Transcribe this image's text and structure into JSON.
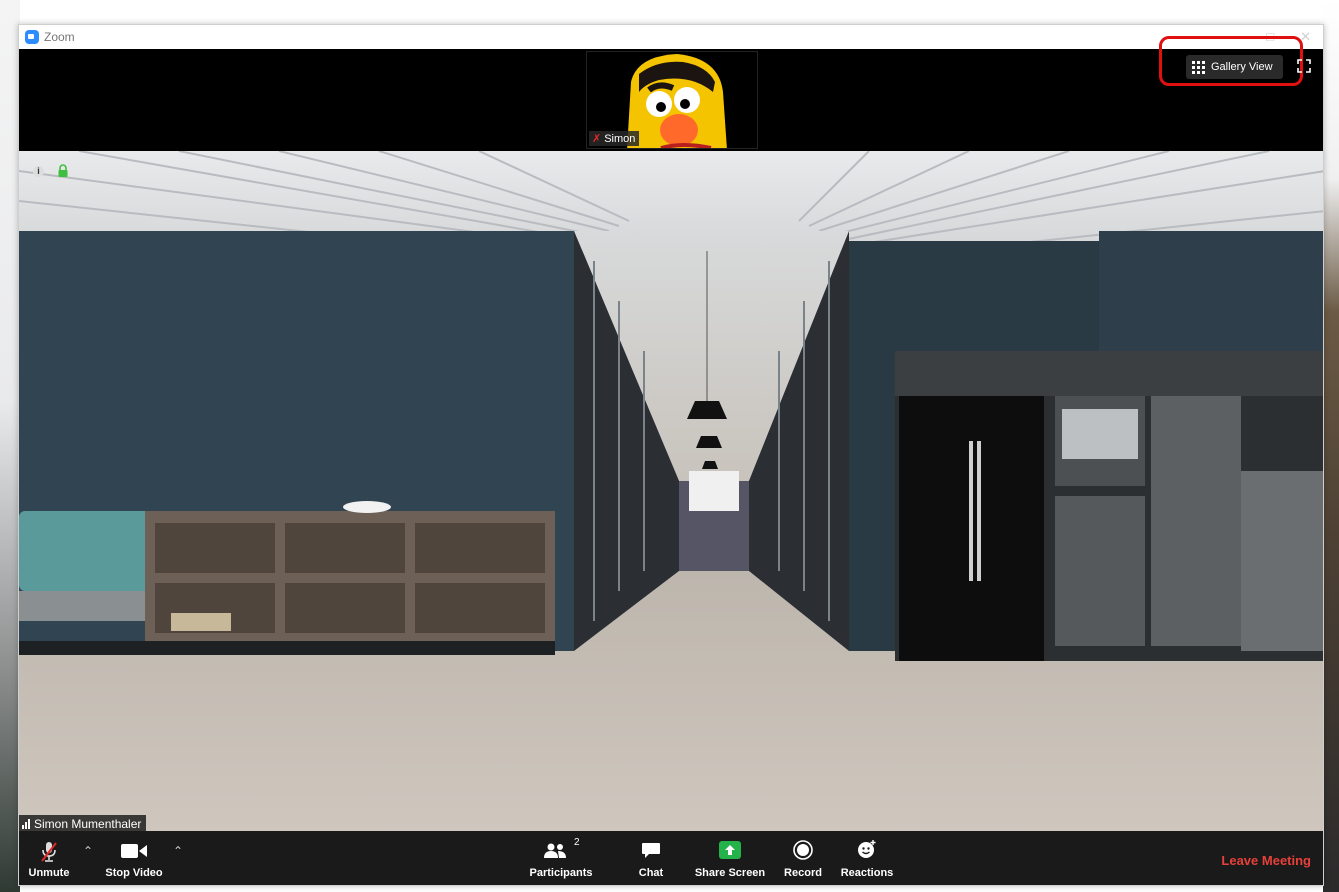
{
  "window": {
    "title": "Zoom"
  },
  "top_strip": {
    "thumbnail_name": "Simon",
    "gallery_view_label": "Gallery View"
  },
  "video": {
    "speaker_name": "Simon Mumenthaler"
  },
  "toolbar": {
    "unmute_label": "Unmute",
    "stop_video_label": "Stop Video",
    "participants_label": "Participants",
    "participants_count": "2",
    "chat_label": "Chat",
    "share_screen_label": "Share Screen",
    "record_label": "Record",
    "reactions_label": "Reactions",
    "leave_label": "Leave Meeting"
  },
  "colors": {
    "leave": "#e8403a",
    "share_screen": "#24b34a",
    "highlight": "#e01010",
    "muted_mic": "#e02828"
  }
}
